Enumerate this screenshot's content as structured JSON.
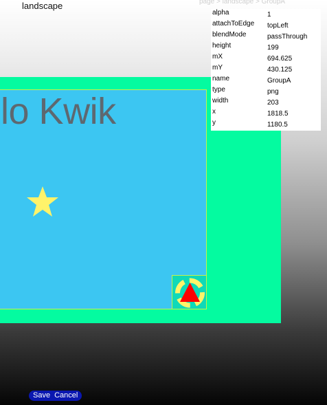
{
  "header": {
    "title": "landscape",
    "breadcrumb": "page > landscape > GroupA"
  },
  "canvas": {
    "heading": "ello Kwik",
    "colors": {
      "outer_panel": "#04fba0",
      "inner_panel": "#3cc6f2",
      "star": "#fff36a",
      "triangle": "#ff0000"
    }
  },
  "properties": [
    {
      "key": "alpha",
      "value": "1"
    },
    {
      "key": "attachToEdge",
      "value": "topLeft"
    },
    {
      "key": "blendMode",
      "value": "passThrough"
    },
    {
      "key": "height",
      "value": "199"
    },
    {
      "key": "mX",
      "value": "694.625"
    },
    {
      "key": "mY",
      "value": "430.125"
    },
    {
      "key": "name",
      "value": "GroupA"
    },
    {
      "key": "type",
      "value": "png"
    },
    {
      "key": "width",
      "value": "203"
    },
    {
      "key": "x",
      "value": "1818.5"
    },
    {
      "key": "y",
      "value": "1180.5"
    }
  ],
  "footer": {
    "save_label": "Save",
    "cancel_label": "Cancel"
  }
}
